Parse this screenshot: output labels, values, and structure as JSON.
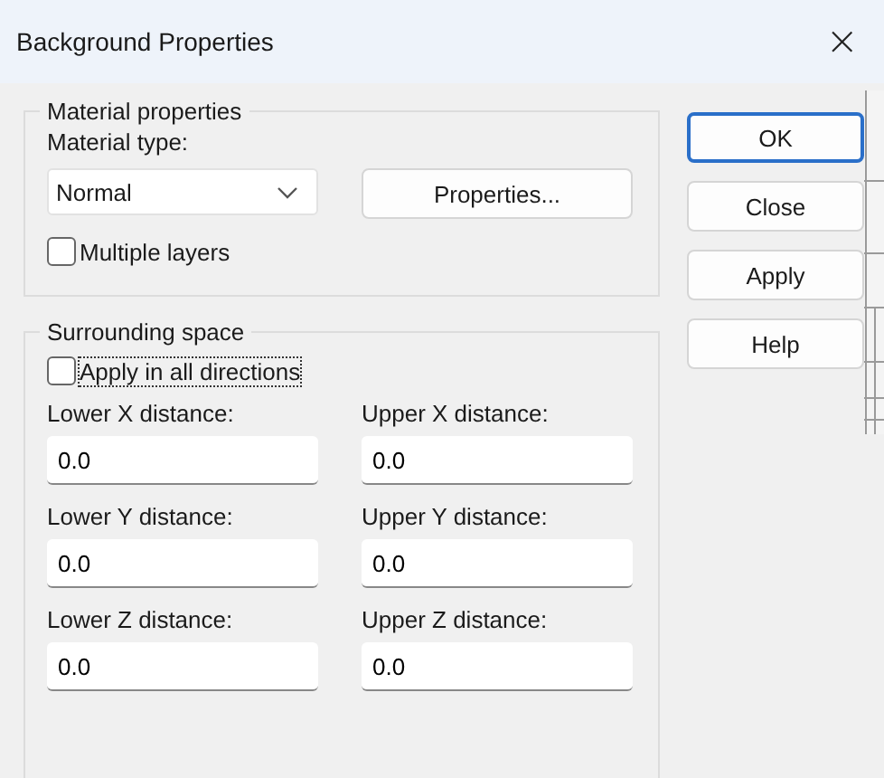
{
  "window": {
    "title": "Background Properties",
    "close": "×"
  },
  "material": {
    "title": "Material properties",
    "type_label": "Material type:",
    "type_value": "Normal",
    "properties_button": "Properties...",
    "multiple_layers": {
      "label": "Multiple layers",
      "checked": false
    }
  },
  "surrounding": {
    "title": "Surrounding space",
    "all_directions": {
      "label": "Apply in all directions",
      "checked": false,
      "focused": true
    },
    "fields": [
      {
        "label": "Lower X distance:",
        "value": "0.0"
      },
      {
        "label": "Upper X distance:",
        "value": "0.0"
      },
      {
        "label": "Lower Y distance:",
        "value": "0.0"
      },
      {
        "label": "Upper Y distance:",
        "value": "0.0"
      },
      {
        "label": "Lower Z distance:",
        "value": "0.0"
      },
      {
        "label": "Upper Z distance:",
        "value": "0.0"
      }
    ]
  },
  "buttons": [
    {
      "label": "OK",
      "default": true
    },
    {
      "label": "Close",
      "default": false
    },
    {
      "label": "Apply",
      "default": false
    },
    {
      "label": "Help",
      "default": false
    }
  ]
}
